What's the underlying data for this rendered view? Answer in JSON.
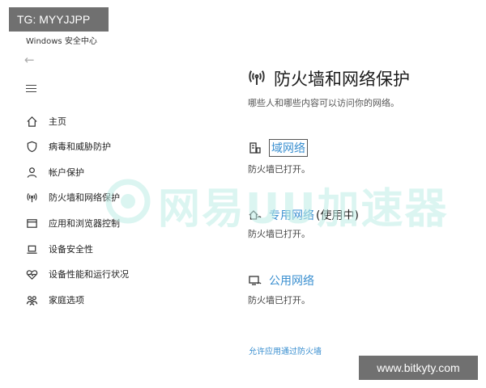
{
  "overlay": {
    "top_tag": "TG: MYYJJPP",
    "bottom_tag": "www.bitkyty.com",
    "watermark": "网易UU加速器"
  },
  "window": {
    "title": "Windows 安全中心"
  },
  "sidebar": {
    "back_icon": "back-arrow-icon",
    "menu_icon": "hamburger-menu-icon",
    "items": [
      {
        "label": "主页",
        "icon": "home-icon"
      },
      {
        "label": "病毒和威胁防护",
        "icon": "shield-icon"
      },
      {
        "label": "帐户保护",
        "icon": "person-icon"
      },
      {
        "label": "防火墙和网络保护",
        "icon": "wifi-antenna-icon"
      },
      {
        "label": "应用和浏览器控制",
        "icon": "browser-window-icon"
      },
      {
        "label": "设备安全性",
        "icon": "laptop-icon"
      },
      {
        "label": "设备性能和运行状况",
        "icon": "heart-pulse-icon"
      },
      {
        "label": "家庭选项",
        "icon": "family-icon"
      }
    ]
  },
  "main": {
    "title": "防火墙和网络保护",
    "title_icon": "wifi-antenna-icon",
    "subtitle": "哪些人和哪些内容可以访问你的网络。",
    "networks": [
      {
        "name": "域网络",
        "suffix": "",
        "status": "防火墙已打开。",
        "icon": "domain-network-icon"
      },
      {
        "name": "专用网络",
        "suffix": "(使用中)",
        "status": "防火墙已打开。",
        "icon": "private-network-icon"
      },
      {
        "name": "公用网络",
        "suffix": "",
        "status": "防火墙已打开。",
        "icon": "public-network-icon"
      }
    ],
    "allow_link": "允许应用通过防火墙"
  },
  "colors": {
    "accent": "#3a8fd0",
    "watermark": "#bfeee6",
    "tag_bg": "#707070"
  }
}
